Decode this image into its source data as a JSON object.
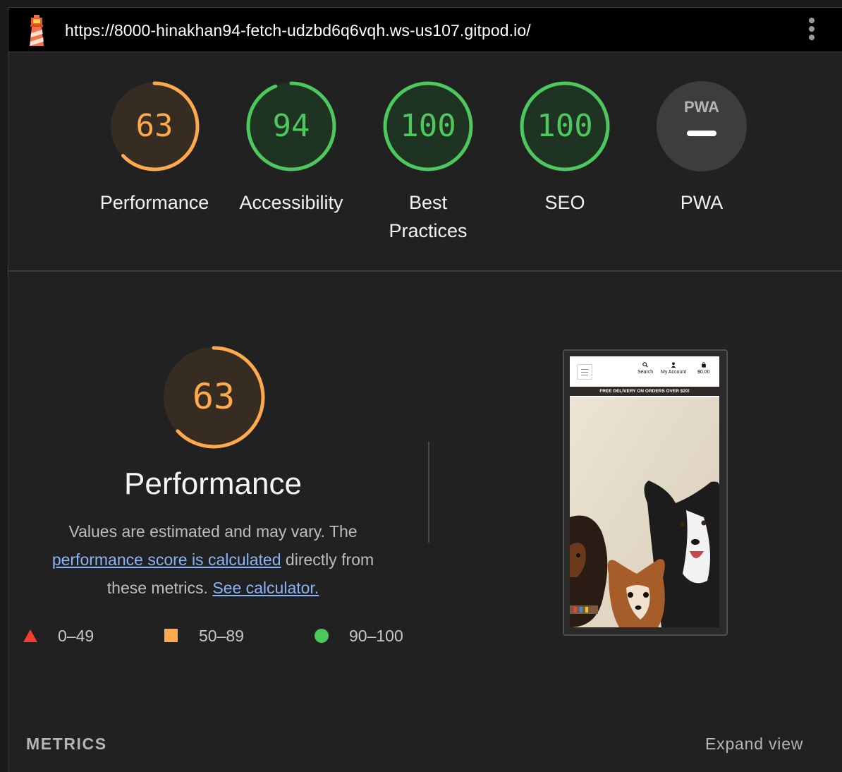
{
  "topbar": {
    "url": "https://8000-hinakhan94-fetch-udzbd6q6vqh.ws-us107.gitpod.io/"
  },
  "gauges": [
    {
      "score": "63",
      "label": "Performance",
      "fraction": 0.63,
      "color": "#ffa94d"
    },
    {
      "score": "94",
      "label": "Accessibility",
      "fraction": 0.94,
      "color": "#4cc85c"
    },
    {
      "score": "100",
      "label": "Best Practices",
      "fraction": 1.0,
      "color": "#4cc85c"
    },
    {
      "score": "100",
      "label": "SEO",
      "fraction": 1.0,
      "color": "#4cc85c"
    },
    {
      "score": "",
      "label": "PWA",
      "fraction": 0,
      "color": "#999999",
      "badge": "PWA"
    }
  ],
  "performance": {
    "score": "63",
    "fraction": 0.63,
    "title": "Performance",
    "desc_1": "Values are estimated and may vary. The",
    "link_1": "performance score is calculated",
    "desc_2": "directly from these metrics.",
    "link_2": "See calculator."
  },
  "legend": {
    "fail": "0–49",
    "average": "50–89",
    "pass": "90–100"
  },
  "thumbnail": {
    "nav_search": "Search",
    "nav_account": "My Account",
    "nav_cart": "$0.00",
    "banner": "FREE DELIVERY ON ORDERS OVER $20!"
  },
  "metrics": {
    "title": "METRICS",
    "expand": "Expand view"
  },
  "colors": {
    "fail": "#f33f33",
    "average": "#ffa94d",
    "pass": "#4cc85c",
    "link": "#8ab4f8"
  }
}
